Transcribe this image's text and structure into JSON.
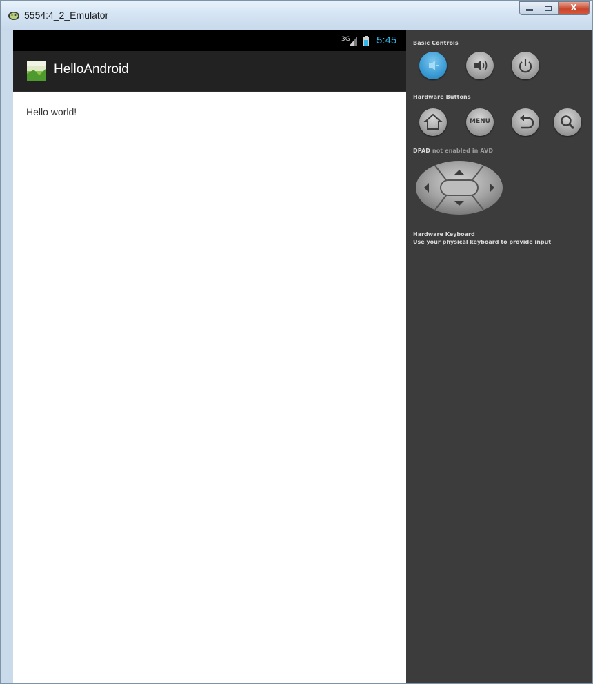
{
  "window": {
    "title": "5554:4_2_Emulator",
    "close_glyph": "X"
  },
  "status_bar": {
    "network": "3G",
    "time": "5:45"
  },
  "app": {
    "title": "HelloAndroid",
    "body_text": "Hello world!"
  },
  "controls": {
    "basic_controls_label": "Basic Controls",
    "hardware_buttons_label": "Hardware Buttons",
    "menu_label": "MENU",
    "dpad_label": "DPAD",
    "dpad_status": "not enabled in AVD",
    "keyboard_label": "Hardware Keyboard",
    "keyboard_hint": "Use your physical keyboard to provide input"
  },
  "colors": {
    "accent_clock": "#33b5e5",
    "active_button": "#3a9bd5",
    "panel_bg": "#3c3c3c",
    "action_bar_bg": "#222222"
  },
  "icons": {
    "title_bar": "android-icon",
    "launcher": "android-launcher-icon",
    "signal": "signal-icon",
    "battery": "battery-icon"
  }
}
